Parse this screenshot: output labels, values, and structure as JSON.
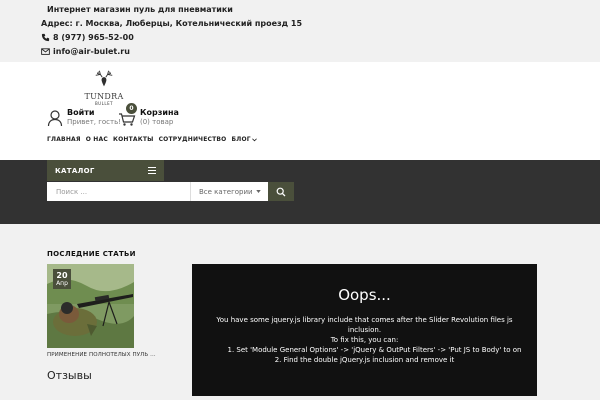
{
  "topbar": {
    "tagline": "Интернет магазин пуль для пневматики",
    "address": "Адрес: г. Москва, Люберцы, Котельнический проезд 15",
    "phone": "8 (977) 965-52-00",
    "email": "info@air-bulet.ru"
  },
  "logo": {
    "brand": "TUNDRA",
    "sub": "BULLET"
  },
  "account": {
    "login_label": "Войти",
    "greeting": "Привет, гость!"
  },
  "cart": {
    "label": "Корзина",
    "count": "0",
    "summary": "(0) товар"
  },
  "nav": {
    "items": [
      "ГЛАВНАЯ",
      "О НАС",
      "КОНТАКТЫ",
      "СОТРУДНИЧЕСТВО",
      "БЛОГ"
    ]
  },
  "catalog": {
    "label": "КАТАЛОГ"
  },
  "search": {
    "placeholder": "Поиск ...",
    "category": "Все категории"
  },
  "sidebar": {
    "title": "ПОСЛЕДНИЕ СТАТЬИ",
    "article": {
      "day": "20",
      "month": "Апр",
      "title": "ПРИМЕНЕНИЕ ПОЛНОТЕЛЫХ ПУЛЬ ..."
    },
    "reviews_title": "Отзывы"
  },
  "error": {
    "heading": "Oops...",
    "message": "You have some jquery.js library include that comes after the Slider Revolution files js inclusion.",
    "fix_intro": "To fix this, you can:",
    "step1": "1. Set 'Module General Options' -> 'jQuery & OutPut Filters' -> 'Put JS to Body' to on",
    "step2": "2. Find the double jQuery.js inclusion and remove it"
  },
  "colors": {
    "accent": "#4a4f3b",
    "band": "#323232",
    "topbar": "#f1f1f1"
  }
}
